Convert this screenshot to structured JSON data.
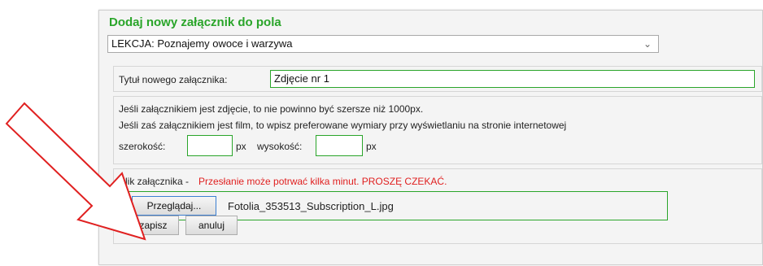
{
  "dialog": {
    "title": "Dodaj nowy załącznik do pola",
    "lesson_select": "LEKCJA: Poznajemy owoce i warzywa"
  },
  "title_row": {
    "label": "Tytuł nowego załącznika:",
    "value": "Zdjęcie nr 1"
  },
  "dimensions": {
    "line1": "Jeśli załącznikiem jest zdjęcie, to nie powinno być szersze niż 1000px.",
    "line2": "Jeśli zaś załącznikiem jest film, to wpisz preferowane wymiary przy wyświetlaniu na stronie internetowej",
    "width_label": "szerokość:",
    "width_value": "",
    "width_unit": "px",
    "height_label": "wysokość:",
    "height_value": "",
    "height_unit": "px"
  },
  "file": {
    "label": "Plik załącznika -",
    "warning": "Przesłanie może potrwać kilka minut. PROSZĘ CZEKAĆ.",
    "browse_label": "Przeglądaj...",
    "file_name": "Fotolia_353513_Subscription_L.jpg"
  },
  "actions": {
    "save_label": "zapisz",
    "cancel_label": "anuluj"
  },
  "colors": {
    "accent_green": "#2aa52a",
    "warning_red": "#e02020",
    "arrow_red": "#e02020"
  }
}
